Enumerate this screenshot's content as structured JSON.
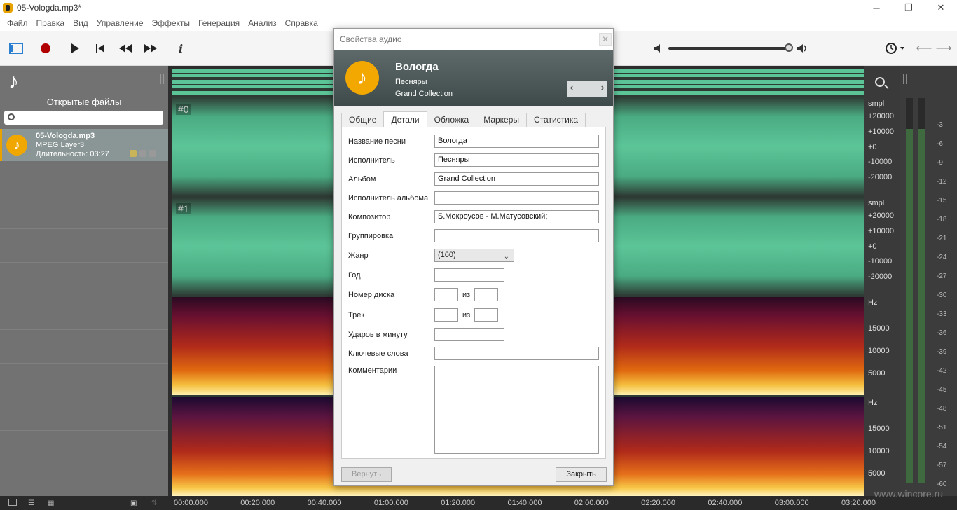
{
  "window": {
    "title": "05-Vologda.mp3*"
  },
  "menu": [
    "Файл",
    "Правка",
    "Вид",
    "Управление",
    "Эффекты",
    "Генерация",
    "Анализ",
    "Справка"
  ],
  "left_panel": {
    "title": "Открытые файлы",
    "file": {
      "name": "05-Vologda.mp3",
      "type": "MPEG Layer3",
      "duration": "Длительность: 03:27"
    }
  },
  "waveform": {
    "channels": [
      "#0",
      "#1"
    ]
  },
  "scale": {
    "ch0": [
      "smpl",
      "+20000",
      "+10000",
      "+0",
      "-10000",
      "-20000"
    ],
    "ch1": [
      "smpl",
      "+20000",
      "+10000",
      "+0",
      "-10000",
      "-20000"
    ],
    "spec0": [
      "Hz",
      "15000",
      "10000",
      "5000"
    ],
    "spec1": [
      "Hz",
      "15000",
      "10000",
      "5000"
    ]
  },
  "meter_db": [
    "-3",
    "-6",
    "-9",
    "-12",
    "-15",
    "-18",
    "-21",
    "-24",
    "-27",
    "-30",
    "-33",
    "-36",
    "-39",
    "-42",
    "-45",
    "-48",
    "-51",
    "-54",
    "-57",
    "-60"
  ],
  "timeline": [
    "00:00.000",
    "00:20.000",
    "00:40.000",
    "01:00.000",
    "01:20.000",
    "01:40.000",
    "02:00.000",
    "02:20.000",
    "02:40.000",
    "03:00.000",
    "03:20.000"
  ],
  "dialog": {
    "title": "Свойства аудио",
    "header": {
      "song": "Вологда",
      "artist": "Песняры",
      "album": "Grand Collection"
    },
    "tabs": [
      "Общие",
      "Детали",
      "Обложка",
      "Маркеры",
      "Статистика"
    ],
    "active_tab": "Детали",
    "fields": {
      "title_label": "Название песни",
      "title_value": "Вологда",
      "artist_label": "Исполнитель",
      "artist_value": "Песняры",
      "album_label": "Альбом",
      "album_value": "Grand Collection",
      "album_artist_label": "Исполнитель альбома",
      "album_artist_value": "",
      "composer_label": "Композитор",
      "composer_value": "Б.Мокроусов - М.Матусовский;",
      "grouping_label": "Группировка",
      "grouping_value": "",
      "genre_label": "Жанр",
      "genre_value": "(160)",
      "year_label": "Год",
      "year_value": "",
      "disc_label": "Номер диска",
      "disc_of": "из",
      "track_label": "Трек",
      "track_of": "из",
      "bpm_label": "Ударов в минуту",
      "bpm_value": "",
      "keywords_label": "Ключевые слова",
      "keywords_value": "",
      "comments_label": "Комментарии",
      "comments_value": ""
    },
    "buttons": {
      "revert": "Вернуть",
      "close": "Закрыть"
    }
  },
  "watermark": "www.wincore.ru",
  "colors": {
    "waveform": "#5cc598",
    "accent": "#e8a200",
    "dialog_header": "#4a5656"
  }
}
